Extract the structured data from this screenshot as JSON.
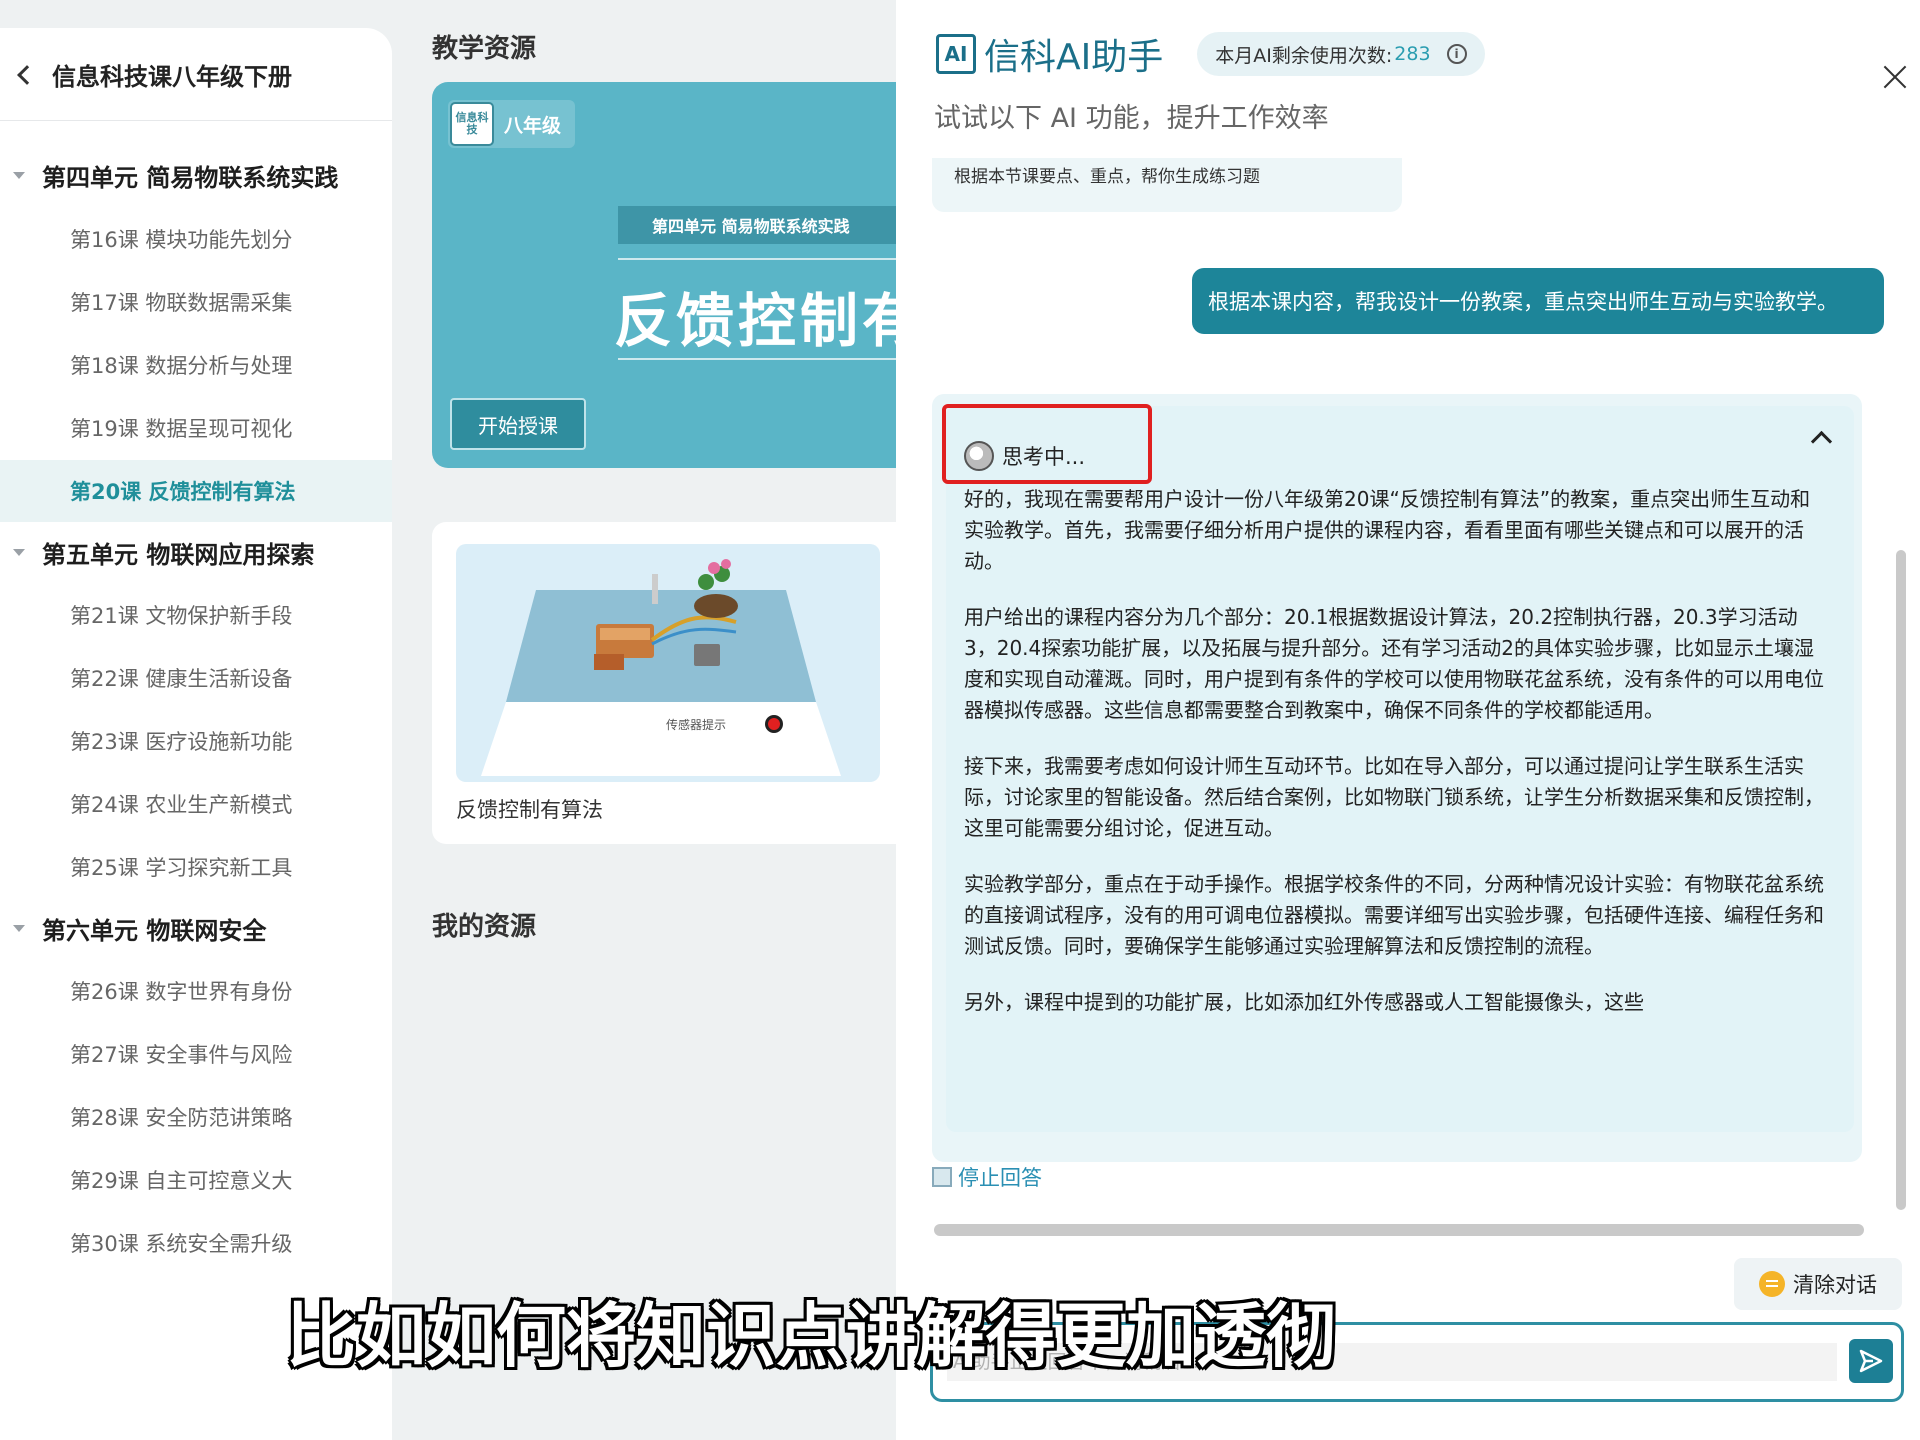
{
  "sidebar": {
    "course_title": "信息科技课八年级下册",
    "units": [
      {
        "label": "第四单元 简易物联系统实践"
      },
      {
        "label": "第五单元 物联网应用探索"
      },
      {
        "label": "第六单元 物联网安全"
      }
    ],
    "lessons": [
      {
        "label": "第16课 模块功能先划分"
      },
      {
        "label": "第17课 物联数据需采集"
      },
      {
        "label": "第18课 数据分析与处理"
      },
      {
        "label": "第19课 数据呈现可视化"
      },
      {
        "label": "第20课 反馈控制有算法"
      },
      {
        "label": "第21课 文物保护新手段"
      },
      {
        "label": "第22课 健康生活新设备"
      },
      {
        "label": "第23课 医疗设施新功能"
      },
      {
        "label": "第24课 农业生产新模式"
      },
      {
        "label": "第25课 学习探究新工具"
      },
      {
        "label": "第26课 数字世界有身份"
      },
      {
        "label": "第27课 安全事件与风险"
      },
      {
        "label": "第28课 安全防范讲策略"
      },
      {
        "label": "第29课 自主可控意义大"
      },
      {
        "label": "第30课 系统安全需升级"
      }
    ]
  },
  "main": {
    "section_teaching": "教学资源",
    "section_mine": "我的资源",
    "hero": {
      "logo_text": "信息科技",
      "grade": "八年级",
      "unit_strip": "第四单元  简易物联系统实践",
      "lesson_title": "反馈控制有算法",
      "start_button": "开始授课"
    },
    "resource": {
      "thumb_label": "传感器提示",
      "caption": "反馈控制有算法"
    }
  },
  "ai": {
    "logo": "AI",
    "title": "信科AI助手",
    "usage_label": "本月AI剩余使用次数:",
    "usage_count": "283",
    "subtitle": "试试以下 AI 功能，提升工作效率",
    "prev_prompt": "根据本节课要点、重点，帮你生成练习题",
    "user_message": "根据本课内容，帮我设计一份教案，重点突出师生互动与实验教学。",
    "thinking_label": "思考中...",
    "answer_paragraphs": [
      "好的，我现在需要帮用户设计一份八年级第20课“反馈控制有算法”的教案，重点突出师生互动和实验教学。首先，我需要仔细分析用户提供的课程内容，看看里面有哪些关键点和可以展开的活动。",
      "用户给出的课程内容分为几个部分：20.1根据数据设计算法，20.2控制执行器，20.3学习活动3，20.4探索功能扩展，以及拓展与提升部分。还有学习活动2的具体实验步骤，比如显示土壤湿度和实现自动灌溉。同时，用户提到有条件的学校可以使用物联花盆系统，没有条件的可以用电位器模拟传感器。这些信息都需要整合到教案中，确保不同条件的学校都能适用。",
      "接下来，我需要考虑如何设计师生互动环节。比如在导入部分，可以通过提问让学生联系生活实际，讨论家里的智能设备。然后结合案例，比如物联门锁系统，让学生分析数据采集和反馈控制，这里可能需要分组讨论，促进互动。",
      "实验教学部分，重点在于动手操作。根据学校条件的不同，分两种情况设计实验：有物联花盆系统的直接调试程序，没有的用可调电位器模拟。需要详细写出实验步骤，包括硬件连接、编程任务和测试反馈。同时，要确保学生能够通过实验理解算法和反馈控制的流程。",
      "另外，课程中提到的功能扩展，比如添加红外传感器或人工智能摄像头，这些"
    ],
    "stop_label": "停止回答",
    "clear_label": "清除对话",
    "input_placeholder": "AI助手正在回答中，请稍后..."
  },
  "caption": "比如如何将知识点讲解得更加透彻",
  "colors": {
    "accent": "#1d8599",
    "highlight_box": "#e02020",
    "active_lesson": "#1f8f9a"
  }
}
